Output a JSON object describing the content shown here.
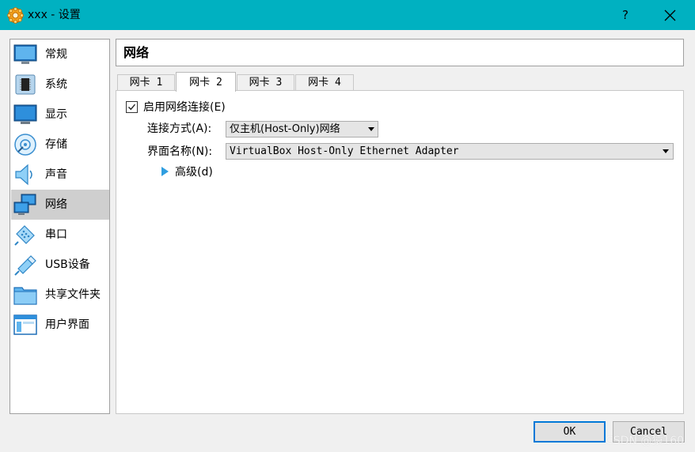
{
  "window": {
    "title": "xxx - 设置",
    "help_label": "?",
    "app_icon": "gear-icon",
    "titlebar_color": "#00b1c1"
  },
  "sidebar": {
    "items": [
      {
        "label": "常规",
        "icon": "general-monitor-icon"
      },
      {
        "label": "系统",
        "icon": "system-chip-icon"
      },
      {
        "label": "显示",
        "icon": "display-monitor-icon"
      },
      {
        "label": "存储",
        "icon": "storage-disk-icon"
      },
      {
        "label": "声音",
        "icon": "audio-speaker-icon"
      },
      {
        "label": "网络",
        "icon": "network-icon"
      },
      {
        "label": "串口",
        "icon": "serial-port-icon"
      },
      {
        "label": "USB设备",
        "icon": "usb-icon"
      },
      {
        "label": "共享文件夹",
        "icon": "shared-folder-icon"
      },
      {
        "label": "用户界面",
        "icon": "user-interface-icon"
      }
    ],
    "selected_label": "网络"
  },
  "page": {
    "title": "网络"
  },
  "tabs": [
    {
      "label": "网卡 1",
      "active": false
    },
    {
      "label": "网卡 2",
      "active": true
    },
    {
      "label": "网卡 3",
      "active": false
    },
    {
      "label": "网卡 4",
      "active": false
    }
  ],
  "adapter": {
    "enable_label": "启用网络连接(E)",
    "enable_checked": true,
    "attached_label": "连接方式(A):",
    "attached_value": "仅主机(Host-Only)网络",
    "name_label": "界面名称(N):",
    "name_value": "VirtualBox Host-Only Ethernet Adapter",
    "advanced_label": "高级(d)"
  },
  "buttons": {
    "ok": "OK",
    "cancel": "Cancel"
  },
  "watermark": "CSDN @猿160"
}
